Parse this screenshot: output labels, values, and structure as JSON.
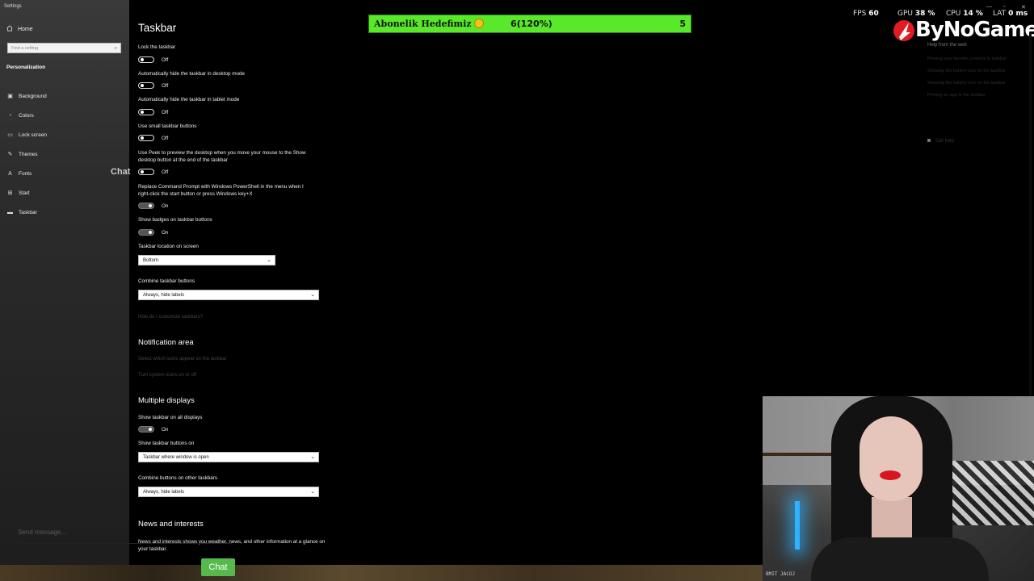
{
  "window": {
    "title": "Settings"
  },
  "sidebar": {
    "home_label": "Home",
    "search_placeholder": "Find a setting",
    "section_label": "Personalization",
    "items": [
      {
        "label": "Background",
        "icon": "image-icon"
      },
      {
        "label": "Colors",
        "icon": "palette-icon"
      },
      {
        "label": "Lock screen",
        "icon": "monitor-icon"
      },
      {
        "label": "Themes",
        "icon": "brush-icon"
      },
      {
        "label": "Fonts",
        "icon": "font-icon"
      },
      {
        "label": "Start",
        "icon": "start-grid-icon"
      },
      {
        "label": "Taskbar",
        "icon": "taskbar-icon"
      }
    ]
  },
  "page": {
    "title": "Taskbar",
    "settings": [
      {
        "label": "Lock the taskbar",
        "state": "Off",
        "on": false
      },
      {
        "label": "Automatically hide the taskbar in desktop mode",
        "state": "Off",
        "on": false
      },
      {
        "label": "Automatically hide the taskbar in tablet mode",
        "state": "Off",
        "on": false
      },
      {
        "label": "Use small taskbar buttons",
        "state": "Off",
        "on": false
      },
      {
        "label": "Use Peek to preview the desktop when you move your mouse to the Show desktop button at the end of the taskbar",
        "state": "Off",
        "on": false
      },
      {
        "label": "Replace Command Prompt with Windows PowerShell in the menu when I right-click the start button or press Windows key+X",
        "state": "On",
        "on": true
      },
      {
        "label": "Show badges on taskbar buttons",
        "state": "On",
        "on": true
      }
    ],
    "location": {
      "label": "Taskbar location on screen",
      "value": "Bottom"
    },
    "combine": {
      "label": "Combine taskbar buttons",
      "value": "Always, hide labels"
    },
    "customize_link": "How do I customize taskbars?",
    "notification": {
      "title": "Notification area",
      "link1": "Select which icons appear on the taskbar",
      "link2": "Turn system icons on or off"
    },
    "multiple": {
      "title": "Multiple displays",
      "show_all_label": "Show taskbar on all displays",
      "show_all_state": "On",
      "show_buttons_label": "Show taskbar buttons on",
      "show_buttons_value": "Taskbar where window is open",
      "combine_other_label": "Combine buttons on other taskbars",
      "combine_other_value": "Always, hide labels"
    },
    "news": {
      "title": "News and interests",
      "desc": "News and interests shows you weather, news, and other information at a glance on your taskbar."
    }
  },
  "help": {
    "heading": "Help from the web",
    "links": [
      "Pinning your favorite contacts to taskbar",
      "Showing the battery icon on the taskbar",
      "Showing the battery icon on the taskbar",
      "Pinning an app to the taskbar"
    ],
    "get_help": "Get help"
  },
  "overlay": {
    "goal": {
      "title": "Abonelik Hedefimiz",
      "progress": "6(120%)",
      "target": "5"
    },
    "stats": {
      "fps_label": "FPS",
      "fps_value": "60",
      "gpu_label": "GPU",
      "gpu_value": "38 %",
      "cpu_label": "CPU",
      "cpu_value": "14 %",
      "lat_label": "LAT",
      "lat_value": "0 ms"
    },
    "brand": "ByNoGame",
    "chat_watermark": "Chat",
    "message_placeholder": "Send message...",
    "chat_button": "Chat",
    "cam_caption": "BMIT JACOJ"
  },
  "colors": {
    "goal_bar": "#59e82a",
    "chat_button": "#56b94b",
    "lips": "#d8161d"
  }
}
